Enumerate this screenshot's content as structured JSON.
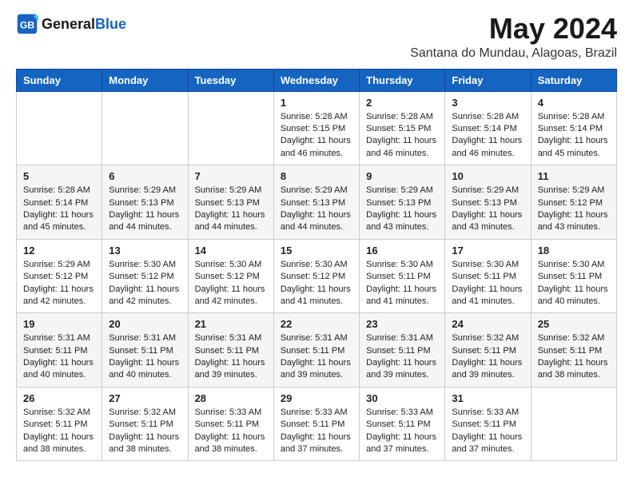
{
  "logo": {
    "general": "General",
    "blue": "Blue"
  },
  "title": "May 2024",
  "location": "Santana do Mundau, Alagoas, Brazil",
  "days_of_week": [
    "Sunday",
    "Monday",
    "Tuesday",
    "Wednesday",
    "Thursday",
    "Friday",
    "Saturday"
  ],
  "weeks": [
    [
      {
        "day": "",
        "info": ""
      },
      {
        "day": "",
        "info": ""
      },
      {
        "day": "",
        "info": ""
      },
      {
        "day": "1",
        "info": "Sunrise: 5:28 AM\nSunset: 5:15 PM\nDaylight: 11 hours and 46 minutes."
      },
      {
        "day": "2",
        "info": "Sunrise: 5:28 AM\nSunset: 5:15 PM\nDaylight: 11 hours and 46 minutes."
      },
      {
        "day": "3",
        "info": "Sunrise: 5:28 AM\nSunset: 5:14 PM\nDaylight: 11 hours and 46 minutes."
      },
      {
        "day": "4",
        "info": "Sunrise: 5:28 AM\nSunset: 5:14 PM\nDaylight: 11 hours and 45 minutes."
      }
    ],
    [
      {
        "day": "5",
        "info": "Sunrise: 5:28 AM\nSunset: 5:14 PM\nDaylight: 11 hours and 45 minutes."
      },
      {
        "day": "6",
        "info": "Sunrise: 5:29 AM\nSunset: 5:13 PM\nDaylight: 11 hours and 44 minutes."
      },
      {
        "day": "7",
        "info": "Sunrise: 5:29 AM\nSunset: 5:13 PM\nDaylight: 11 hours and 44 minutes."
      },
      {
        "day": "8",
        "info": "Sunrise: 5:29 AM\nSunset: 5:13 PM\nDaylight: 11 hours and 44 minutes."
      },
      {
        "day": "9",
        "info": "Sunrise: 5:29 AM\nSunset: 5:13 PM\nDaylight: 11 hours and 43 minutes."
      },
      {
        "day": "10",
        "info": "Sunrise: 5:29 AM\nSunset: 5:13 PM\nDaylight: 11 hours and 43 minutes."
      },
      {
        "day": "11",
        "info": "Sunrise: 5:29 AM\nSunset: 5:12 PM\nDaylight: 11 hours and 43 minutes."
      }
    ],
    [
      {
        "day": "12",
        "info": "Sunrise: 5:29 AM\nSunset: 5:12 PM\nDaylight: 11 hours and 42 minutes."
      },
      {
        "day": "13",
        "info": "Sunrise: 5:30 AM\nSunset: 5:12 PM\nDaylight: 11 hours and 42 minutes."
      },
      {
        "day": "14",
        "info": "Sunrise: 5:30 AM\nSunset: 5:12 PM\nDaylight: 11 hours and 42 minutes."
      },
      {
        "day": "15",
        "info": "Sunrise: 5:30 AM\nSunset: 5:12 PM\nDaylight: 11 hours and 41 minutes."
      },
      {
        "day": "16",
        "info": "Sunrise: 5:30 AM\nSunset: 5:11 PM\nDaylight: 11 hours and 41 minutes."
      },
      {
        "day": "17",
        "info": "Sunrise: 5:30 AM\nSunset: 5:11 PM\nDaylight: 11 hours and 41 minutes."
      },
      {
        "day": "18",
        "info": "Sunrise: 5:30 AM\nSunset: 5:11 PM\nDaylight: 11 hours and 40 minutes."
      }
    ],
    [
      {
        "day": "19",
        "info": "Sunrise: 5:31 AM\nSunset: 5:11 PM\nDaylight: 11 hours and 40 minutes."
      },
      {
        "day": "20",
        "info": "Sunrise: 5:31 AM\nSunset: 5:11 PM\nDaylight: 11 hours and 40 minutes."
      },
      {
        "day": "21",
        "info": "Sunrise: 5:31 AM\nSunset: 5:11 PM\nDaylight: 11 hours and 39 minutes."
      },
      {
        "day": "22",
        "info": "Sunrise: 5:31 AM\nSunset: 5:11 PM\nDaylight: 11 hours and 39 minutes."
      },
      {
        "day": "23",
        "info": "Sunrise: 5:31 AM\nSunset: 5:11 PM\nDaylight: 11 hours and 39 minutes."
      },
      {
        "day": "24",
        "info": "Sunrise: 5:32 AM\nSunset: 5:11 PM\nDaylight: 11 hours and 39 minutes."
      },
      {
        "day": "25",
        "info": "Sunrise: 5:32 AM\nSunset: 5:11 PM\nDaylight: 11 hours and 38 minutes."
      }
    ],
    [
      {
        "day": "26",
        "info": "Sunrise: 5:32 AM\nSunset: 5:11 PM\nDaylight: 11 hours and 38 minutes."
      },
      {
        "day": "27",
        "info": "Sunrise: 5:32 AM\nSunset: 5:11 PM\nDaylight: 11 hours and 38 minutes."
      },
      {
        "day": "28",
        "info": "Sunrise: 5:33 AM\nSunset: 5:11 PM\nDaylight: 11 hours and 38 minutes."
      },
      {
        "day": "29",
        "info": "Sunrise: 5:33 AM\nSunset: 5:11 PM\nDaylight: 11 hours and 37 minutes."
      },
      {
        "day": "30",
        "info": "Sunrise: 5:33 AM\nSunset: 5:11 PM\nDaylight: 11 hours and 37 minutes."
      },
      {
        "day": "31",
        "info": "Sunrise: 5:33 AM\nSunset: 5:11 PM\nDaylight: 11 hours and 37 minutes."
      },
      {
        "day": "",
        "info": ""
      }
    ]
  ]
}
